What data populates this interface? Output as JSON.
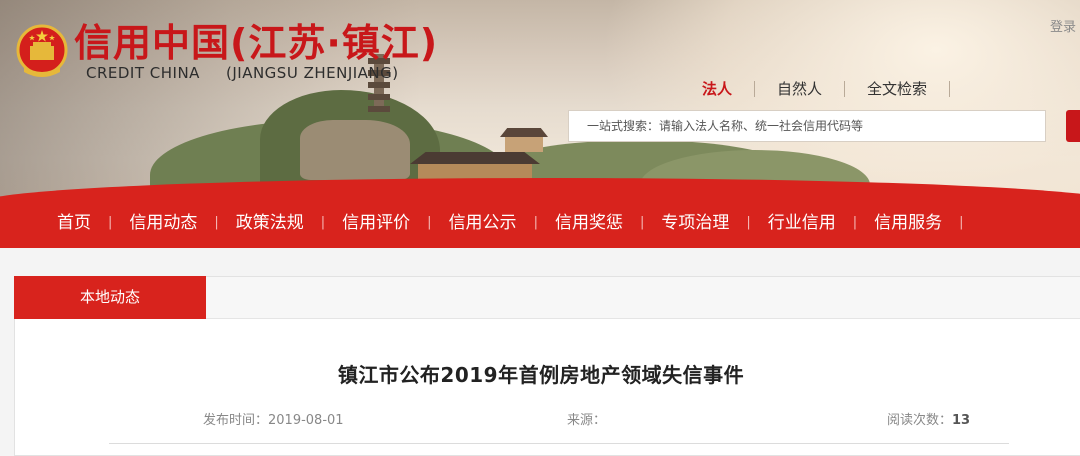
{
  "header": {
    "logo_cn": "信用中国(江苏·镇江)",
    "logo_en": "CREDIT CHINA",
    "logo_en_region": "(JIANGSU ZHENJIANG)",
    "emblem_icon": "national-emblem-icon",
    "login_label": "登录"
  },
  "search": {
    "tabs": [
      {
        "label": "法人",
        "active": true
      },
      {
        "label": "自然人",
        "active": false
      },
      {
        "label": "全文检索",
        "active": false
      }
    ],
    "placeholder": "一站式搜索：请输入法人名称、统一社会信用代码等",
    "button_icon": "search-icon"
  },
  "nav": {
    "items": [
      {
        "label": "首页"
      },
      {
        "label": "信用动态"
      },
      {
        "label": "政策法规"
      },
      {
        "label": "信用评价"
      },
      {
        "label": "信用公示"
      },
      {
        "label": "信用奖惩"
      },
      {
        "label": "专项治理"
      },
      {
        "label": "行业信用"
      },
      {
        "label": "信用服务"
      }
    ]
  },
  "content": {
    "category_tab": "本地动态",
    "article": {
      "title": "镇江市公布2019年首例房地产领域失信事件",
      "date_label": "发布时间：",
      "date": "2019-08-01",
      "source_label": "来源：",
      "source": "",
      "reads_label": "阅读次数：",
      "reads": "13"
    }
  },
  "colors": {
    "brand_red": "#d8231d",
    "logo_red": "#c8171a"
  }
}
